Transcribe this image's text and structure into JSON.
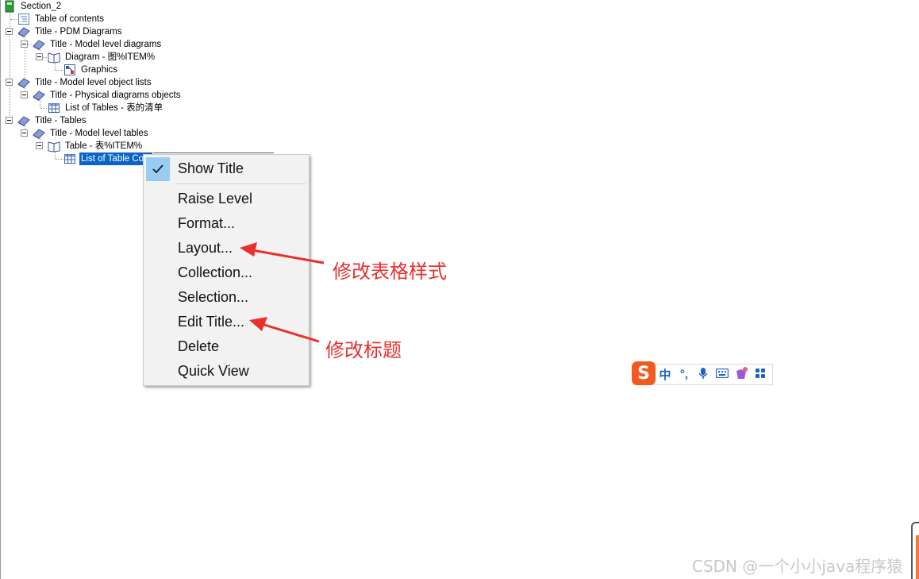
{
  "tree": {
    "section": "Section_2",
    "toc": "Table of contents",
    "title_pdm": "Title - PDM Diagrams",
    "title_model_diagrams": "Title - Model level diagrams",
    "diagram_item": "Diagram - 图%ITEM%",
    "graphics": "Graphics",
    "title_model_object_lists": "Title - Model level object lists",
    "title_physical_objects": "Title - Physical diagrams objects",
    "list_of_tables": "List of Tables - 表的清单",
    "title_tables": "Title - Tables",
    "title_model_tables": "Title - Model level tables",
    "table_item": "Table - 表%ITEM%",
    "list_of_table_columns": "List of Table Colu"
  },
  "menu": {
    "items": [
      {
        "label": "Show Title",
        "checked": true
      },
      {
        "label": "Raise Level"
      },
      {
        "label": "Format..."
      },
      {
        "label": "Layout..."
      },
      {
        "label": "Collection..."
      },
      {
        "label": "Selection..."
      },
      {
        "label": "Edit Title..."
      },
      {
        "label": "Delete"
      },
      {
        "label": "Quick View"
      }
    ]
  },
  "annotations": {
    "layout_note": "修改表格样式",
    "title_note": "修改标题",
    "color": "#e8302c"
  },
  "ime": {
    "logo": "S",
    "lang": "中",
    "punct": "°,",
    "icons": [
      "microphone-icon",
      "keyboard-icon",
      "skin-icon",
      "apps-grid-icon"
    ]
  },
  "watermark": "CSDN @一个小小java程序猿"
}
